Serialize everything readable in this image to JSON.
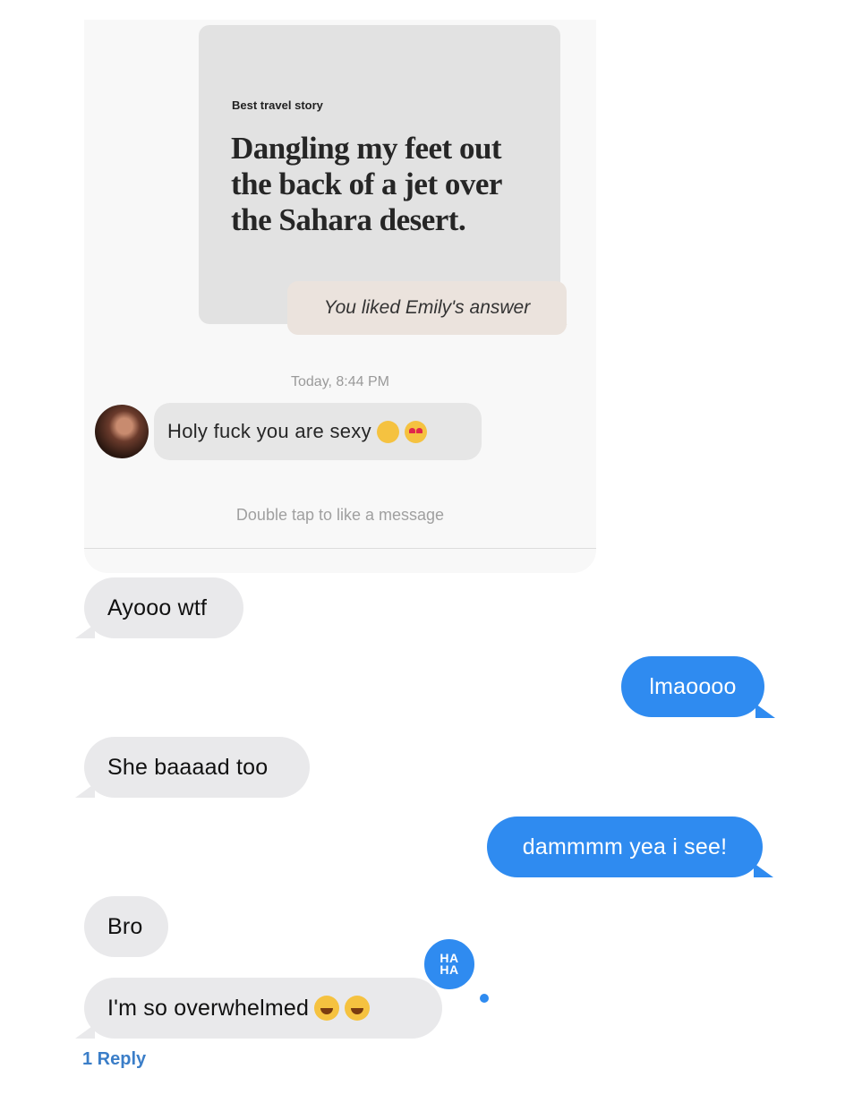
{
  "embedded_screenshot": {
    "prompt_label": "Best travel story",
    "prompt_answer": "Dangling my feet out the back of a jet over the Sahara desert.",
    "liked_text": "You liked Emily's answer",
    "timestamp": "Today, 8:44 PM",
    "incoming_message": "Holy fuck you are sexy",
    "incoming_emojis": [
      "smiling-face-icon",
      "heart-eyes-face-icon"
    ],
    "hint": "Double tap to like a message"
  },
  "messages": [
    {
      "side": "left",
      "text": "Ayooo wtf"
    },
    {
      "side": "right",
      "text": "lmaoooo"
    },
    {
      "side": "left",
      "text": "She baaaad too"
    },
    {
      "side": "right",
      "text": "dammmm yea i see!"
    },
    {
      "side": "left",
      "text": "Bro"
    },
    {
      "side": "left",
      "text": "I'm so overwhelmed",
      "emojis": [
        "laughing-tears-icon",
        "laughing-tears-icon"
      ]
    }
  ],
  "reaction": {
    "label_top": "HA",
    "label_bottom": "HA",
    "color": "#2f8bf0"
  },
  "reply_link": "1 Reply",
  "colors": {
    "incoming_bubble": "#e9e9eb",
    "outgoing_bubble": "#2f8bf0",
    "link": "#3b7ec8"
  }
}
